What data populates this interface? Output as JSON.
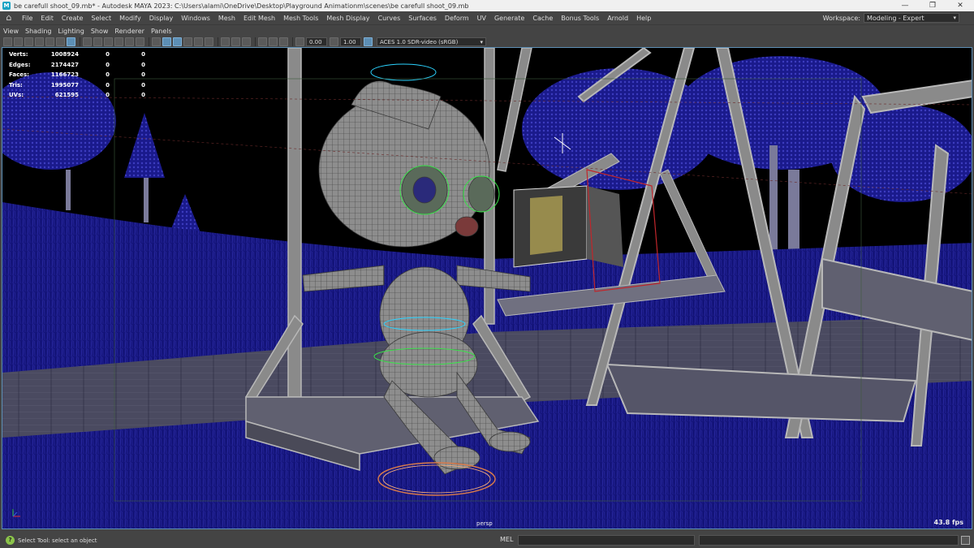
{
  "window": {
    "title": "be carefull shoot_09.mb* - Autodesk MAYA 2023: C:\\Users\\alami\\OneDrive\\Desktop\\Playground Animationm\\scenes\\be carefull shoot_09.mb",
    "minimize": "—",
    "maximize": "❐",
    "close": "✕"
  },
  "menu": {
    "items": [
      "File",
      "Edit",
      "Create",
      "Select",
      "Modify",
      "Display",
      "Windows",
      "Mesh",
      "Edit Mesh",
      "Mesh Tools",
      "Mesh Display",
      "Curves",
      "Surfaces",
      "Deform",
      "UV",
      "Generate",
      "Cache",
      "Bonus Tools",
      "Arnold",
      "Help"
    ],
    "workspace_label": "Workspace:",
    "workspace_value": "Modeling - Expert"
  },
  "panel_menu": [
    "View",
    "Shading",
    "Lighting",
    "Show",
    "Renderer",
    "Panels"
  ],
  "toolbar": {
    "exposure": "0.00",
    "gamma": "1.00",
    "color_space": "ACES 1.0 SDR-video (sRGB)"
  },
  "hud": {
    "rows": [
      {
        "label": "Verts:",
        "v1": "1008924",
        "v2": "0",
        "v3": "0"
      },
      {
        "label": "Edges:",
        "v1": "2174427",
        "v2": "0",
        "v3": "0"
      },
      {
        "label": "Faces:",
        "v1": "1166723",
        "v2": "0",
        "v3": "0"
      },
      {
        "label": "Tris:",
        "v1": "1995077",
        "v2": "0",
        "v3": "0"
      },
      {
        "label": "UVs:",
        "v1": "621595",
        "v2": "0",
        "v3": "0"
      }
    ]
  },
  "viewport": {
    "camera": "persp",
    "fps": "43.8 fps"
  },
  "status": {
    "help_text": "Select Tool: select an object",
    "mel_label": "MEL"
  },
  "colors": {
    "ui_bg": "#444444",
    "viewport_bg": "#000000",
    "wire_blue": "#1a1a8c",
    "wire_light": "#3a3ab0",
    "mesh_grey": "#8a8a8a",
    "accent": "#5d8fb5"
  }
}
